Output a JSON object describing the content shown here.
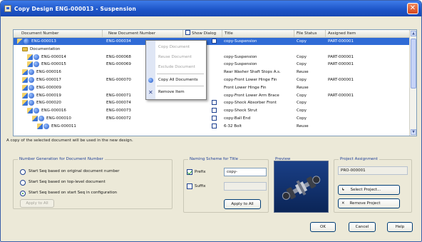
{
  "window": {
    "title": "Copy Design  ENG-000013 - Suspension"
  },
  "grid": {
    "columns": [
      "Document Number",
      "New Document Number",
      "Show Dialog",
      "Title",
      "File Status",
      "Assigned Item"
    ],
    "rows": [
      {
        "indent": 0,
        "icons": [
          "asm",
          "part"
        ],
        "doc": "ENG-000013",
        "new": "ENG-000034",
        "title": "copy-Suspension",
        "status": "Copy",
        "item": "PART-000001",
        "selected": true,
        "checkbox": true
      },
      {
        "indent": 1,
        "icons": [
          "fold"
        ],
        "doc": "Documentation",
        "new": "",
        "title": "",
        "status": "",
        "item": "",
        "checkbox": false
      },
      {
        "indent": 2,
        "icons": [
          "asm",
          "part"
        ],
        "doc": "ENG-000014",
        "new": "ENG-000068",
        "title": "copy-Suspension",
        "status": "Copy",
        "item": "PART-000001",
        "checkbox": false
      },
      {
        "indent": 2,
        "icons": [
          "asm",
          "part"
        ],
        "doc": "ENG-000015",
        "new": "ENG-000069",
        "title": "copy-Suspension",
        "status": "Copy",
        "item": "PART-000001",
        "checkbox": false
      },
      {
        "indent": 1,
        "icons": [
          "asm",
          "part"
        ],
        "doc": "ENG-000016",
        "new": "",
        "title": "Rear Washer Shaft Stops A.s.",
        "status": "Reuse",
        "item": "",
        "checkbox": false
      },
      {
        "indent": 1,
        "icons": [
          "asm",
          "part"
        ],
        "doc": "ENG-000017",
        "new": "ENG-000070",
        "title": "copy-Front Lower Hinge Fin",
        "status": "Copy",
        "item": "PART-000001",
        "checkbox": false
      },
      {
        "indent": 1,
        "icons": [
          "asm",
          "part"
        ],
        "doc": "ENG-000009",
        "new": "",
        "title": "Front Lower Hinge Fin",
        "status": "Reuse",
        "item": "",
        "checkbox": false
      },
      {
        "indent": 1,
        "icons": [
          "asm",
          "part"
        ],
        "doc": "ENG-000019",
        "new": "ENG-000071",
        "title": "copy-Front Lower Arm Brace",
        "status": "Copy",
        "item": "PART-000001",
        "checkbox": false
      },
      {
        "indent": 1,
        "icons": [
          "asm",
          "part"
        ],
        "doc": "ENG-000020",
        "new": "ENG-000074",
        "title": "copy-Shock Absorber Front",
        "status": "Copy",
        "item": "",
        "checkbox": true
      },
      {
        "indent": 2,
        "icons": [
          "asm",
          "part"
        ],
        "doc": "ENG-000016",
        "new": "ENG-000073",
        "title": "copy-Shock Strut",
        "status": "Copy",
        "item": "",
        "checkbox": true
      },
      {
        "indent": 3,
        "icons": [
          "asm",
          "part"
        ],
        "doc": "ENG-000010",
        "new": "ENG-000072",
        "title": "copy-Ball End",
        "status": "Copy",
        "item": "",
        "checkbox": true
      },
      {
        "indent": 4,
        "icons": [
          "asm",
          "part"
        ],
        "doc": "ENG-000011",
        "new": "",
        "title": "6-32 Bolt",
        "status": "Reuse",
        "item": "",
        "checkbox": true
      }
    ]
  },
  "context_menu": {
    "items": [
      {
        "label": "Copy Document",
        "disabled": true
      },
      {
        "label": "Reuse Document",
        "disabled": true
      },
      {
        "label": "Exclude Document",
        "disabled": true
      },
      {
        "label": "Copy All Documents",
        "disabled": false
      },
      {
        "label": "Remove Item",
        "disabled": false
      }
    ]
  },
  "status_line": "A copy of the selected document will be used in the new design.",
  "numbering": {
    "title": "Number Generation for Document Number",
    "options": [
      {
        "label": "Start Seq based on original document number",
        "selected": false
      },
      {
        "label": "Start Seq based on top-level document",
        "selected": false
      },
      {
        "label": "Start Seq based on start Seq in configuration",
        "selected": true
      }
    ],
    "apply_all_label": "Apply to All"
  },
  "naming": {
    "title": "Naming Scheme for Title",
    "prefix_label": "Prefix",
    "prefix_checked": true,
    "prefix_value": "copy-",
    "suffix_label": "Suffix",
    "suffix_checked": false,
    "suffix_value": "",
    "apply_all_label": "Apply to All"
  },
  "preview": {
    "title": "Preview"
  },
  "project": {
    "title": "Project Assignment",
    "value": "PRO-000001",
    "select_label": "Select Project...",
    "remove_label": "Remove Project"
  },
  "buttons": {
    "ok": "OK",
    "cancel": "Cancel",
    "help": "Help"
  },
  "colors": {
    "title_bar": "#1e56c9",
    "selection": "#2f6bd6",
    "dialog_bg": "#ece9d8"
  }
}
